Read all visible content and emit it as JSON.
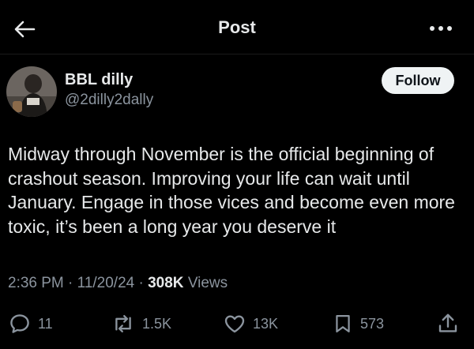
{
  "header": {
    "title": "Post",
    "back_icon": "arrow-left-icon",
    "more_icon": "more-dots-icon"
  },
  "author": {
    "name": "BBL dilly",
    "handle": "@2dilly2dally",
    "follow_label": "Follow"
  },
  "post": {
    "text": "Midway through November is the official beginning of crashout season. Improving your life can wait until January. Engage in those vices and become even more toxic, it’s been a long year you deserve it",
    "time": "2:36 PM",
    "date": "11/20/24",
    "views_count": "308K",
    "views_label": "Views"
  },
  "actions": {
    "replies": "11",
    "reposts": "1.5K",
    "likes": "13K",
    "bookmarks": "573"
  },
  "colors": {
    "background": "#000000",
    "text": "#e7e9ea",
    "muted": "#8b949e",
    "follow_bg": "#eff3f4"
  }
}
